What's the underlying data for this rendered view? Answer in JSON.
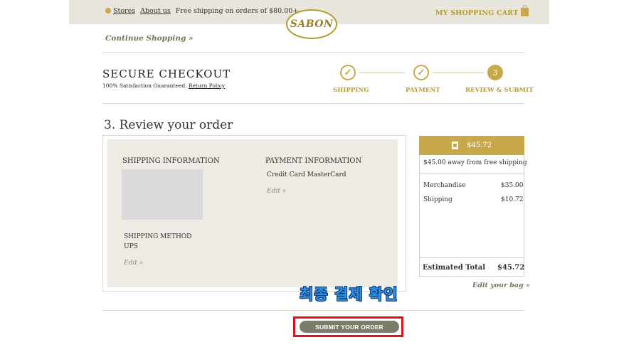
{
  "topbar": {
    "stores": "Stores",
    "about": "About us",
    "shipping_promo": "Free shipping on orders of $80.00+",
    "cart": "MY SHOPPING CART",
    "logo": "SABON",
    "continue": "Continue Shopping »"
  },
  "checkout": {
    "title": "SECURE CHECKOUT",
    "guarantee": "100% Satisfaction Guaranteed.",
    "return_policy": "Return Policy",
    "steps": [
      {
        "label": "SHIPPING",
        "mark": "✓",
        "status": "done"
      },
      {
        "label": "PAYMENT",
        "mark": "✓",
        "status": "done"
      },
      {
        "label": "REVIEW & SUBMIT",
        "mark": "3",
        "status": "active"
      }
    ]
  },
  "review": {
    "title": "3. Review your order",
    "shipping_info": "SHIPPING INFORMATION",
    "payment_info": "PAYMENT INFORMATION",
    "payment_method": "Credit Card MasterCard",
    "edit": "Edit »",
    "shipping_method_label": "SHIPPING METHOD",
    "shipping_method": "UPS"
  },
  "summary": {
    "total_badge": "$45.72",
    "free_ship_msg": "$45.00 away from free shipping",
    "lines": [
      {
        "label": "Merchandise",
        "value": "$35.00"
      },
      {
        "label": "Shipping",
        "value": "$10.72"
      }
    ],
    "estimated_label": "Estimated Total",
    "estimated_value": "$45.72",
    "edit_bag": "Edit your bag »"
  },
  "overlay": {
    "caption": "최종 결제 확인"
  },
  "submit": {
    "label": "SUBMIT YOUR ORDER"
  },
  "colors": {
    "gold": "#c9a84c",
    "olive": "#6b7a56",
    "highlight": "#e01020",
    "caption_blue": "#2f8fe0"
  }
}
